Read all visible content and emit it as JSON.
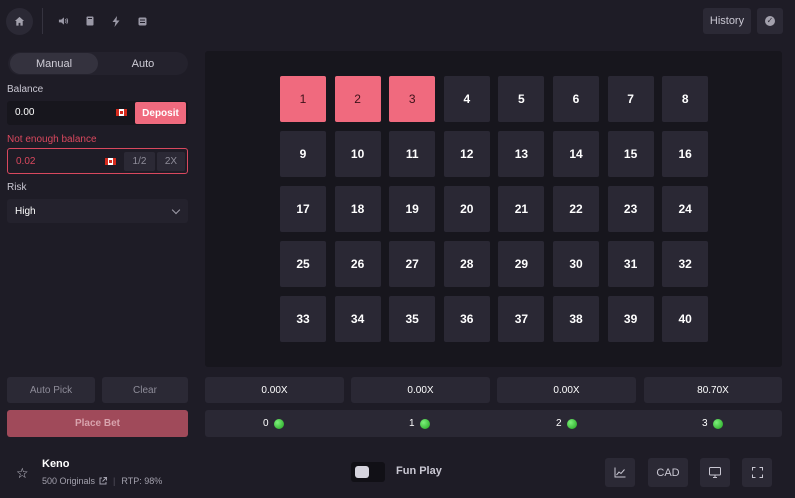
{
  "header": {
    "history_label": "History"
  },
  "tabs": {
    "manual_label": "Manual",
    "auto_label": "Auto"
  },
  "balance": {
    "label": "Balance",
    "value": "0.00",
    "deposit_label": "Deposit"
  },
  "bet": {
    "error_text": "Not enough balance",
    "value": "0.02",
    "half_label": "1/2",
    "double_label": "2X"
  },
  "risk": {
    "label": "Risk",
    "value": "High"
  },
  "actions": {
    "auto_pick_label": "Auto Pick",
    "clear_label": "Clear",
    "place_bet_label": "Place Bet"
  },
  "board": {
    "numbers": [
      "1",
      "2",
      "3",
      "4",
      "5",
      "6",
      "7",
      "8",
      "9",
      "10",
      "11",
      "12",
      "13",
      "14",
      "15",
      "16",
      "17",
      "18",
      "19",
      "20",
      "21",
      "22",
      "23",
      "24",
      "25",
      "26",
      "27",
      "28",
      "29",
      "30",
      "31",
      "32",
      "33",
      "34",
      "35",
      "36",
      "37",
      "38",
      "39",
      "40"
    ],
    "selected": [
      "1",
      "2",
      "3"
    ]
  },
  "payouts": [
    "0.00X",
    "0.00X",
    "0.00X",
    "80.70X"
  ],
  "hits": [
    "0",
    "1",
    "2",
    "3"
  ],
  "footer": {
    "game_title": "Keno",
    "provider": "500 Originals",
    "rtp": "RTP: 98%",
    "fun_play_label": "Fun Play",
    "currency_label": "CAD"
  },
  "colors": {
    "accent": "#f06a7e",
    "error": "#d9485e",
    "tile": "#2a2834",
    "board_bg": "#17161d",
    "gem": "#3cc43a"
  },
  "icons": {
    "home": "home-icon",
    "sound": "speaker-icon",
    "rules": "book-icon",
    "instant": "lightning-icon",
    "hotkeys": "keyboard-icon",
    "fairness": "check-badge-icon",
    "favorite": "star-icon",
    "external": "external-link-icon",
    "stats": "line-chart-icon",
    "theater": "monitor-icon",
    "fullscreen": "fullscreen-icon"
  }
}
